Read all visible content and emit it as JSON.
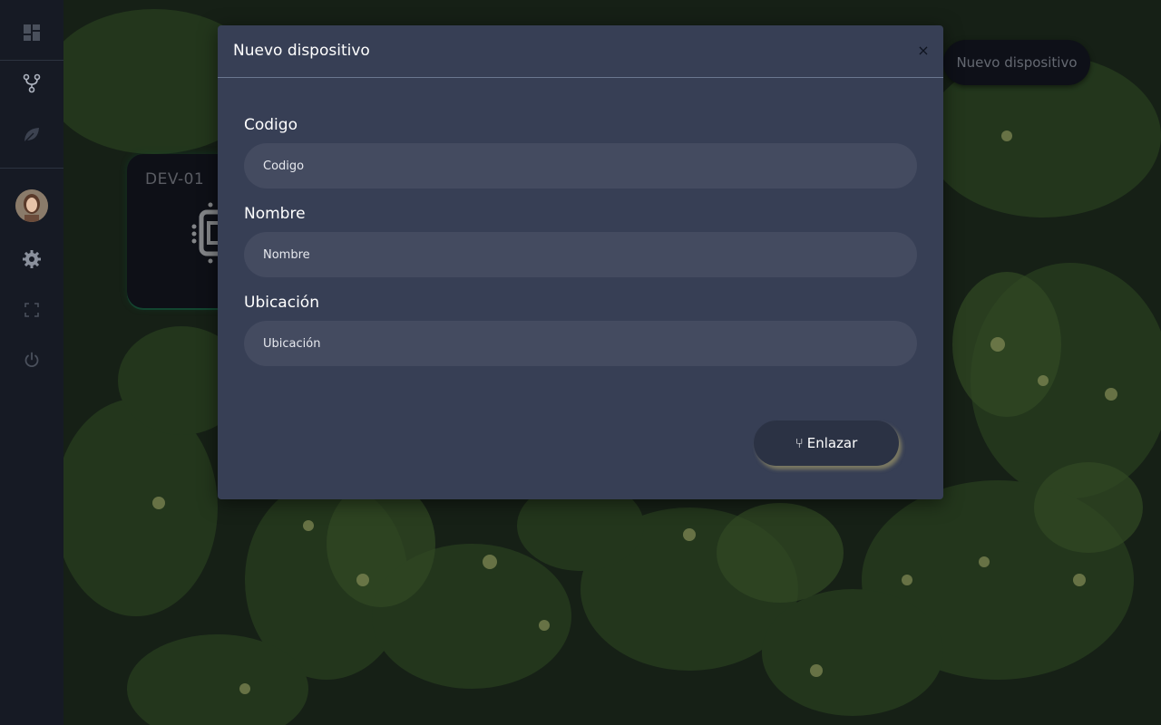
{
  "page": {
    "new_device_button": "Nuevo dispositivo"
  },
  "sidebar": {
    "items": [
      {
        "icon": "dashboard-icon"
      },
      {
        "icon": "branch-icon"
      },
      {
        "icon": "leaf-icon"
      },
      {
        "icon": "avatar"
      },
      {
        "icon": "gear-icon"
      },
      {
        "icon": "fullscreen-icon"
      },
      {
        "icon": "power-icon"
      }
    ]
  },
  "device_card": {
    "code": "DEV-01",
    "icon": "chip-icon"
  },
  "modal": {
    "title": "Nuevo dispositivo",
    "close_label": "×",
    "fields": [
      {
        "label": "Codigo",
        "placeholder": "Codigo"
      },
      {
        "label": "Nombre",
        "placeholder": "Nombre"
      },
      {
        "label": "Ubicación",
        "placeholder": "Ubicación"
      }
    ],
    "submit_icon": "⑂",
    "submit_label": "Enlazar"
  },
  "colors": {
    "modal_bg": "#373f55",
    "sidebar_bg": "#161a24",
    "input_bg": "#444b60",
    "accent_green": "#1e6a4a",
    "button_shadow": "#b4aa6e"
  }
}
